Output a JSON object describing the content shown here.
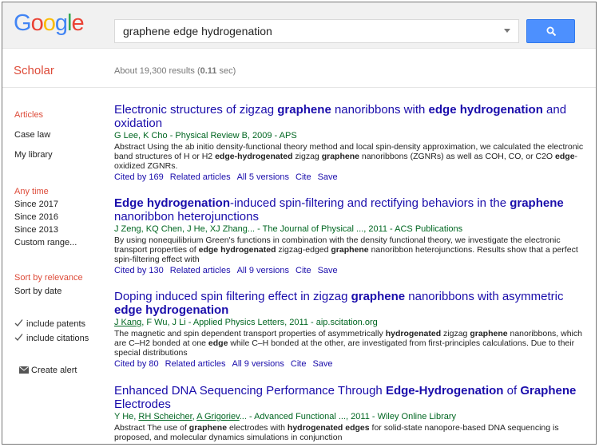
{
  "header": {
    "logo_letters": [
      {
        "char": "G",
        "color": "#4285f4"
      },
      {
        "char": "o",
        "color": "#ea4335"
      },
      {
        "char": "o",
        "color": "#fbbc05"
      },
      {
        "char": "g",
        "color": "#4285f4"
      },
      {
        "char": "l",
        "color": "#34a853"
      },
      {
        "char": "e",
        "color": "#ea4335"
      }
    ],
    "search_query": "graphene edge hydrogenation",
    "search_button_icon": "search-icon",
    "accent_color": "#4d90fe"
  },
  "brand": {
    "label": "Scholar",
    "color": "#dd4b39"
  },
  "stats": {
    "prefix": "About 19,300 results (",
    "time": "0.11",
    "suffix": " sec)"
  },
  "sidebar": {
    "content_types": [
      {
        "label": "Articles",
        "active": true
      },
      {
        "label": "Case law",
        "active": false
      },
      {
        "label": "My library",
        "active": false
      }
    ],
    "time_filters": [
      {
        "label": "Any time",
        "active": true
      },
      {
        "label": "Since 2017",
        "active": false
      },
      {
        "label": "Since 2016",
        "active": false
      },
      {
        "label": "Since 2013",
        "active": false
      },
      {
        "label": "Custom range...",
        "active": false
      }
    ],
    "sort_options": [
      {
        "label": "Sort by relevance",
        "active": true
      },
      {
        "label": "Sort by date",
        "active": false
      }
    ],
    "checkboxes": [
      {
        "label": "include patents",
        "checked": true
      },
      {
        "label": "include citations",
        "checked": true
      }
    ],
    "alert": {
      "label": "Create alert",
      "icon": "envelope-icon"
    }
  },
  "results": [
    {
      "title_runs": [
        {
          "t": "Electronic structures of zigzag ",
          "b": false
        },
        {
          "t": "graphene",
          "b": true
        },
        {
          "t": " nanoribbons with ",
          "b": false
        },
        {
          "t": "edge hydrogenation",
          "b": true
        },
        {
          "t": " and oxidation",
          "b": false
        }
      ],
      "meta_runs": [
        {
          "t": "G Lee, K Cho - Physical Review B, 2009 - APS",
          "u": false
        }
      ],
      "snippet_runs": [
        {
          "t": "Abstract Using the ab initio density-functional theory method and local spin-density approximation, we calculated the electronic band structures of H or H2 ",
          "b": false
        },
        {
          "t": "edge-hydrogenated",
          "b": true
        },
        {
          "t": " zigzag ",
          "b": false
        },
        {
          "t": "graphene",
          "b": true
        },
        {
          "t": " nanoribbons (ZGNRs) as well as COH, CO, or C2O ",
          "b": false
        },
        {
          "t": "edge",
          "b": true
        },
        {
          "t": "-oxidized ZGNRs.",
          "b": false
        }
      ],
      "links": [
        "Cited by 169",
        "Related articles",
        "All 5 versions",
        "Cite",
        "Save"
      ]
    },
    {
      "title_runs": [
        {
          "t": "Edge hydrogenation",
          "b": true
        },
        {
          "t": "-induced spin-filtering and rectifying behaviors in the ",
          "b": false
        },
        {
          "t": "graphene",
          "b": true
        },
        {
          "t": " nanoribbon heterojunctions",
          "b": false
        }
      ],
      "meta_runs": [
        {
          "t": "J Zeng, KQ Chen, J He, XJ Zhang... - The Journal of Physical ..., 2011 - ACS Publications",
          "u": false
        }
      ],
      "snippet_runs": [
        {
          "t": "By using nonequilibrium Green's functions in combination with the density functional theory, we investigate the electronic transport properties of ",
          "b": false
        },
        {
          "t": "edge hydrogenated",
          "b": true
        },
        {
          "t": " zigzag-edged ",
          "b": false
        },
        {
          "t": "graphene",
          "b": true
        },
        {
          "t": " nanoribbon heterojunctions. Results show that a perfect spin-filtering effect with",
          "b": false
        }
      ],
      "links": [
        "Cited by 130",
        "Related articles",
        "All 9 versions",
        "Cite",
        "Save"
      ]
    },
    {
      "title_runs": [
        {
          "t": "Doping induced spin filtering effect in zigzag ",
          "b": false
        },
        {
          "t": "graphene",
          "b": true
        },
        {
          "t": " nanoribbons with asymmetric ",
          "b": false
        },
        {
          "t": "edge hydrogenation",
          "b": true
        }
      ],
      "meta_runs": [
        {
          "t": "J Kang",
          "u": true
        },
        {
          "t": ", F Wu, J Li - Applied Physics Letters, 2011 - aip.scitation.org",
          "u": false
        }
      ],
      "snippet_runs": [
        {
          "t": "The magnetic and spin dependent transport properties of asymmetrically ",
          "b": false
        },
        {
          "t": "hydrogenated",
          "b": true
        },
        {
          "t": " zigzag ",
          "b": false
        },
        {
          "t": "graphene",
          "b": true
        },
        {
          "t": " nanoribbons, which are C–H2 bonded at one ",
          "b": false
        },
        {
          "t": "edge",
          "b": true
        },
        {
          "t": " while C–H bonded at the other, are investigated from first-principles calculations. Due to their special distributions",
          "b": false
        }
      ],
      "links": [
        "Cited by 80",
        "Related articles",
        "All 9 versions",
        "Cite",
        "Save"
      ]
    },
    {
      "title_runs": [
        {
          "t": "Enhanced DNA Sequencing Performance Through ",
          "b": false
        },
        {
          "t": "Edge-Hydrogenation",
          "b": true
        },
        {
          "t": " of ",
          "b": false
        },
        {
          "t": "Graphene",
          "b": true
        },
        {
          "t": " Electrodes",
          "b": false
        }
      ],
      "meta_runs": [
        {
          "t": "Y He, ",
          "u": false
        },
        {
          "t": "RH Scheicher",
          "u": true
        },
        {
          "t": ", ",
          "u": false
        },
        {
          "t": "A Grigoriev",
          "u": true
        },
        {
          "t": "... - Advanced Functional ..., 2011 - Wiley Online Library",
          "u": false
        }
      ],
      "snippet_runs": [
        {
          "t": "Abstract The use of ",
          "b": false
        },
        {
          "t": "graphene",
          "b": true
        },
        {
          "t": " electrodes with ",
          "b": false
        },
        {
          "t": "hydrogenated edges",
          "b": true
        },
        {
          "t": " for solid-state nanopore-based DNA sequencing is proposed, and molecular dynamics simulations in conjunction",
          "b": false
        }
      ],
      "links": []
    }
  ]
}
